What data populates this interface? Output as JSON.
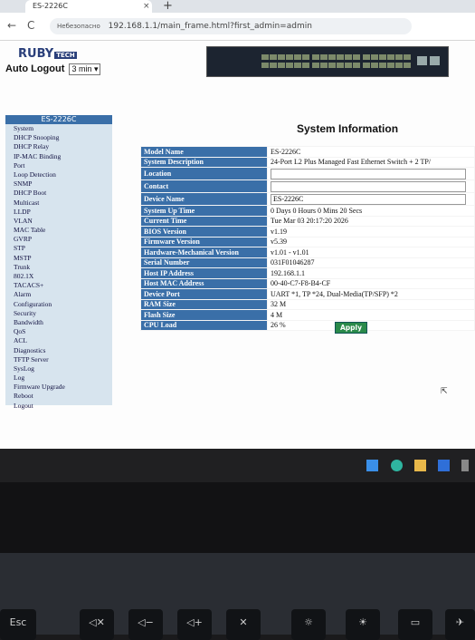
{
  "browser": {
    "tab_title": "ES-2226C",
    "tab_close": "×",
    "new_tab": "+",
    "insecure_label": "Небезопасно",
    "url": "192.168.1.1/main_frame.html?first_admin=admin",
    "back_icon": "←",
    "reload_icon": "C"
  },
  "header": {
    "logo_text": "RUBY",
    "logo_badge": "TECH",
    "auto_logout_label": "Auto Logout",
    "auto_logout_value": "3 min"
  },
  "sidebar": {
    "title": "ES-2226C",
    "items": [
      {
        "label": "System"
      },
      {
        "label": "DHCP Snooping"
      },
      {
        "label": "DHCP Relay"
      },
      {
        "label": "IP-MAC Binding"
      },
      {
        "label": "Port"
      },
      {
        "label": "Loop Detection"
      },
      {
        "label": "SNMP"
      },
      {
        "label": "DHCP Boot"
      },
      {
        "label": "Multicast"
      },
      {
        "label": "LLDP"
      },
      {
        "label": "VLAN"
      },
      {
        "label": "MAC Table"
      },
      {
        "label": "GVRP"
      },
      {
        "label": "STP"
      },
      {
        "label": "MSTP"
      },
      {
        "label": "Trunk"
      },
      {
        "label": "802.1X"
      },
      {
        "label": "TACACS+"
      },
      {
        "label": "Alarm"
      },
      {
        "label": "Configuration"
      },
      {
        "label": "Security"
      },
      {
        "label": "Bandwidth"
      },
      {
        "label": "QoS"
      },
      {
        "label": "ACL"
      },
      {
        "label": "Diagnostics"
      },
      {
        "label": "TFTP Server"
      },
      {
        "label": "SysLog"
      },
      {
        "label": "Log"
      },
      {
        "label": "Firmware Upgrade"
      },
      {
        "label": "Reboot"
      },
      {
        "label": "Logout"
      }
    ]
  },
  "main": {
    "title": "System Information",
    "rows": [
      {
        "label": "Model Name",
        "value": "ES-2226C"
      },
      {
        "label": "System Description",
        "value": "24-Port L2 Plus Managed Fast Ethernet Switch + 2 TP/"
      },
      {
        "label": "Location",
        "value": ""
      },
      {
        "label": "Contact",
        "value": ""
      },
      {
        "label": "Device Name",
        "value": "ES-2226C"
      },
      {
        "label": "System Up Time",
        "value": "0 Days 0 Hours 0 Mins 20 Secs"
      },
      {
        "label": "Current Time",
        "value": "Tue Mar 03 20:17:20 2026"
      },
      {
        "label": "BIOS Version",
        "value": "v1.19"
      },
      {
        "label": "Firmware Version",
        "value": "v5.39"
      },
      {
        "label": "Hardware-Mechanical Version",
        "value": "v1.01 - v1.01"
      },
      {
        "label": "Serial Number",
        "value": "031F01046287"
      },
      {
        "label": "Host IP Address",
        "value": "192.168.1.1"
      },
      {
        "label": "Host MAC Address",
        "value": "00-40-C7-F8-B4-CF"
      },
      {
        "label": "Device Port",
        "value": "UART *1, TP *24, Dual-Media(TP/SFP) *2"
      },
      {
        "label": "RAM Size",
        "value": "32 M"
      },
      {
        "label": "Flash Size",
        "value": "4 M"
      },
      {
        "label": "CPU Load",
        "value": "26 %"
      }
    ],
    "apply_label": "Apply"
  },
  "keyboard": {
    "esc_label": "Esc"
  },
  "colors": {
    "label_bg": "#3a6fa8",
    "sidebar_bg": "#d7e4ee",
    "apply_bg": "#2a8a4a"
  }
}
